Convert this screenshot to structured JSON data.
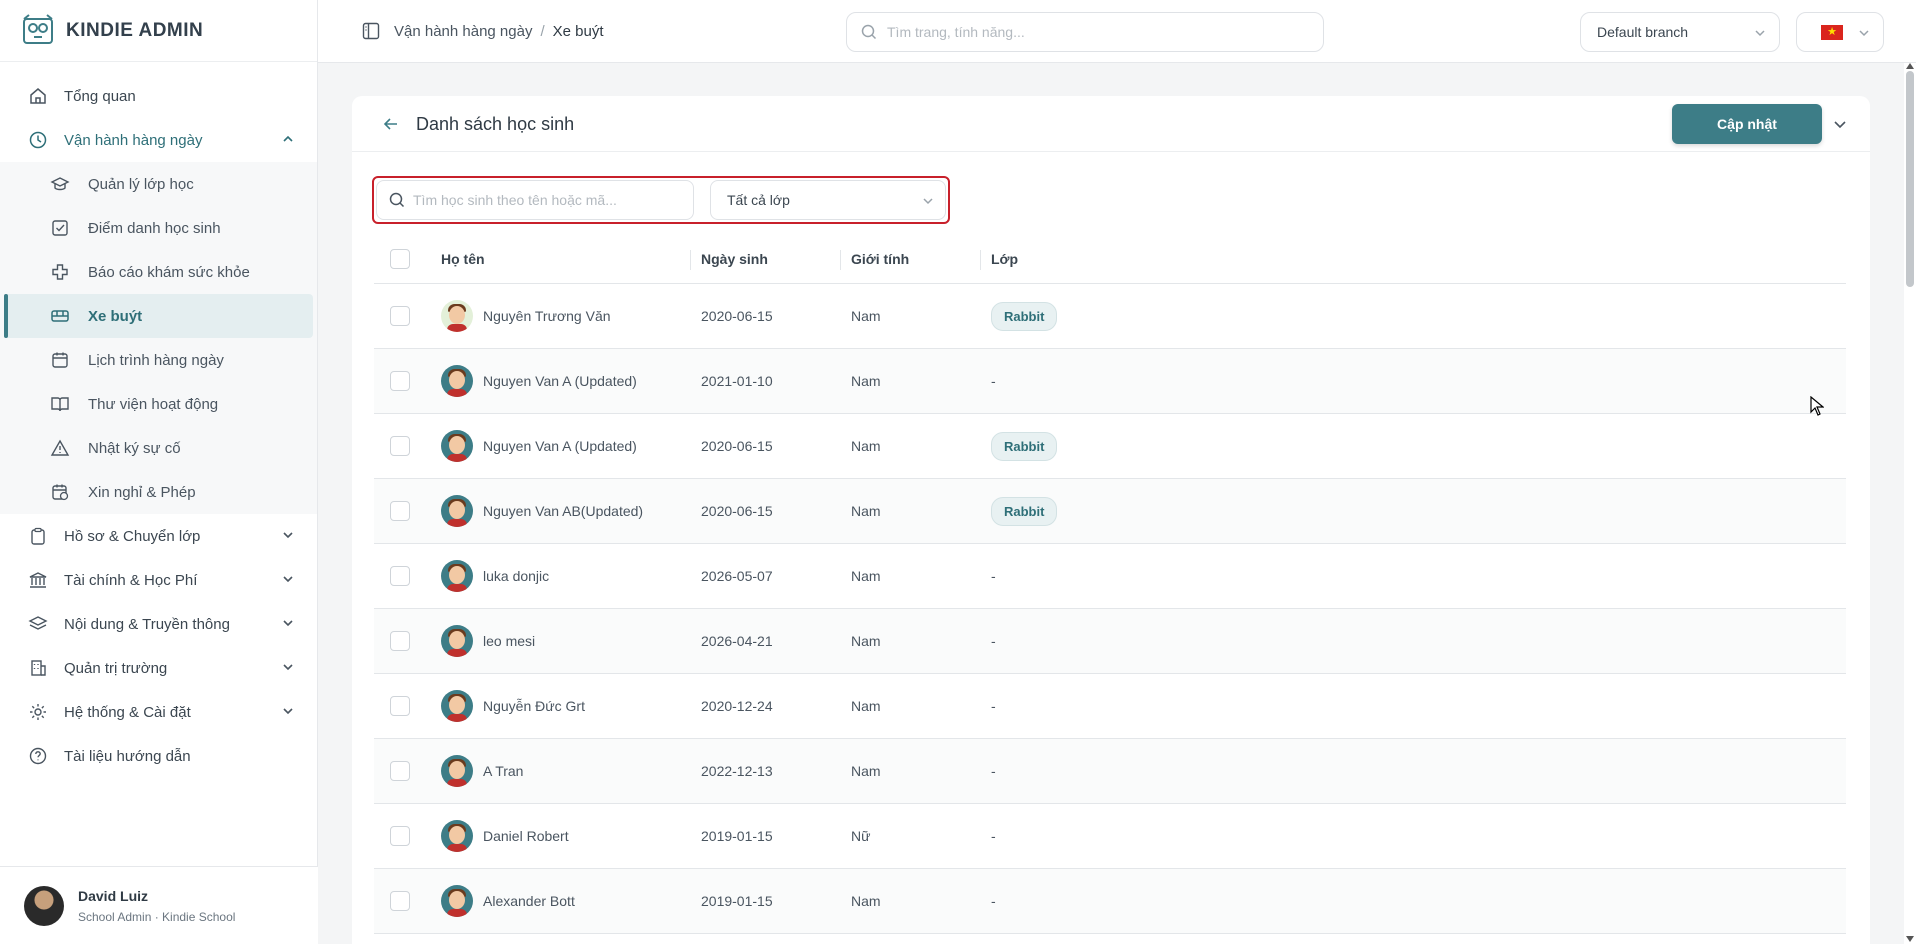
{
  "brand": {
    "name": "KINDIE ADMIN"
  },
  "sidebar": {
    "items": [
      {
        "label": "Tổng quan",
        "icon": "home-icon"
      },
      {
        "label": "Vận hành hàng ngày",
        "icon": "clock-icon",
        "expanded": true
      },
      {
        "label": "Hồ sơ & Chuyển lớp",
        "icon": "clipboard-icon"
      },
      {
        "label": "Tài chính & Học Phí",
        "icon": "bank-icon"
      },
      {
        "label": "Nội dung & Truyền thông",
        "icon": "layers-icon"
      },
      {
        "label": "Quản trị trường",
        "icon": "building-icon"
      },
      {
        "label": "Hệ thống & Cài đặt",
        "icon": "gear-icon"
      },
      {
        "label": "Tài liệu hướng dẫn",
        "icon": "help-circle-icon"
      }
    ],
    "subitems": [
      {
        "label": "Quản lý lớp học",
        "icon": "graduation-cap-icon"
      },
      {
        "label": "Điểm danh học sinh",
        "icon": "checkbox-icon"
      },
      {
        "label": "Báo cáo khám sức khỏe",
        "icon": "medical-cross-icon"
      },
      {
        "label": "Xe buýt",
        "icon": "bus-icon",
        "active": true
      },
      {
        "label": "Lịch trình hàng ngày",
        "icon": "calendar-icon"
      },
      {
        "label": "Thư viện hoạt động",
        "icon": "book-icon"
      },
      {
        "label": "Nhật ký sự cố",
        "icon": "warning-icon"
      },
      {
        "label": "Xin nghỉ & Phép",
        "icon": "calendar-clock-icon"
      }
    ]
  },
  "user": {
    "name": "David Luiz",
    "role": "School Admin · Kindie School"
  },
  "topbar": {
    "breadcrumb": [
      "Vận hành hàng ngày",
      "/",
      "Xe buýt"
    ],
    "search_placeholder": "Tìm trang, tính năng...",
    "branch": "Default branch",
    "language_flag": "vietnam-flag-icon"
  },
  "page": {
    "title": "Danh sách học sinh",
    "update_button": "Cập nhật",
    "student_search_placeholder": "Tìm học sinh theo tên hoặc mã...",
    "class_filter": "Tất cả lớp"
  },
  "table": {
    "columns": [
      "Họ tên",
      "Ngày sinh",
      "Giới tính",
      "Lớp"
    ],
    "rows": [
      {
        "name": "Nguyên Trương Văn",
        "dob": "2020-06-15",
        "gender": "Nam",
        "class": "Rabbit"
      },
      {
        "name": "Nguyen Van A (Updated)",
        "dob": "2021-01-10",
        "gender": "Nam",
        "class": "-"
      },
      {
        "name": "Nguyen Van A (Updated)",
        "dob": "2020-06-15",
        "gender": "Nam",
        "class": "Rabbit"
      },
      {
        "name": "Nguyen Van AB(Updated)",
        "dob": "2020-06-15",
        "gender": "Nam",
        "class": "Rabbit"
      },
      {
        "name": "luka donjic",
        "dob": "2026-05-07",
        "gender": "Nam",
        "class": "-"
      },
      {
        "name": "leo mesi",
        "dob": "2026-04-21",
        "gender": "Nam",
        "class": "-"
      },
      {
        "name": "Nguyễn Đức Grt",
        "dob": "2020-12-24",
        "gender": "Nam",
        "class": "-"
      },
      {
        "name": "A Tran",
        "dob": "2022-12-13",
        "gender": "Nam",
        "class": "-"
      },
      {
        "name": "Daniel Robert",
        "dob": "2019-01-15",
        "gender": "Nữ",
        "class": "-"
      },
      {
        "name": "Alexander Bott",
        "dob": "2019-01-15",
        "gender": "Nam",
        "class": "-"
      }
    ]
  },
  "colors": {
    "accent": "#3d7d87",
    "highlight_border": "#c8202b"
  }
}
